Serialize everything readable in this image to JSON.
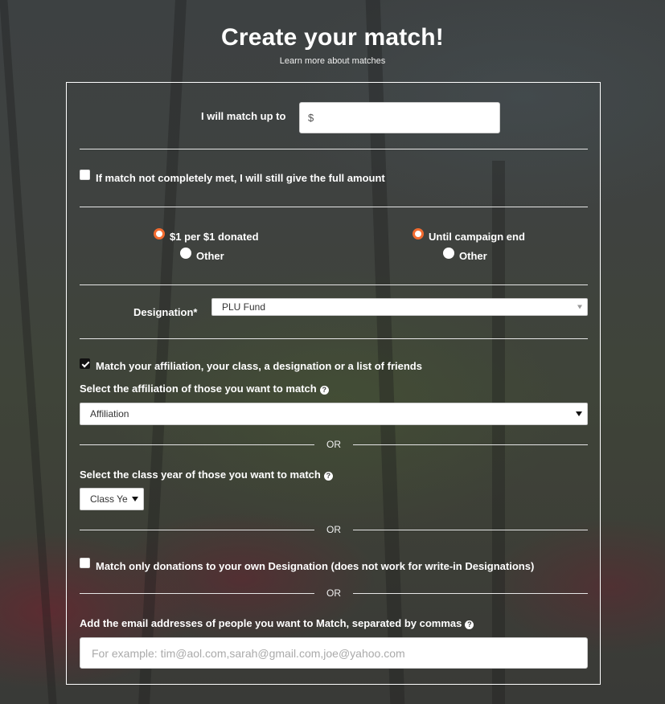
{
  "header": {
    "title": "Create your match!",
    "learn_more_link": "Learn more about matches"
  },
  "match_amount": {
    "label": "I will match up to",
    "value": "$"
  },
  "full_amount_checkbox": {
    "label": "If match not completely met, I will still give the full amount",
    "checked": false
  },
  "ratio_options": [
    {
      "label": "$1 per $1 donated",
      "selected": true
    },
    {
      "label": "Other",
      "selected": false
    }
  ],
  "duration_options": [
    {
      "label": "Until campaign end",
      "selected": true
    },
    {
      "label": "Other",
      "selected": false
    }
  ],
  "designation": {
    "label": "Designation*",
    "selected": "PLU Fund"
  },
  "match_targets_checkbox": {
    "label": "Match your affiliation, your class, a designation or a list of friends",
    "checked": true
  },
  "affiliation": {
    "label": "Select the affiliation of those you want to match",
    "selected": "Affiliation"
  },
  "or_text": "OR",
  "class_year": {
    "label": "Select the class year of those you want to match",
    "selected": "Class Ye"
  },
  "own_designation_checkbox": {
    "label": "Match only donations to your own Designation (does not work for write-in Designations)",
    "checked": false
  },
  "emails": {
    "label": "Add the email addresses of people you want to Match, separated by commas",
    "value": "",
    "placeholder": "For example: tim@aol.com,sarah@gmail.com,joe@yahoo.com"
  },
  "help_glyph": "?",
  "colors": {
    "radio_accent": "#f26b30",
    "text": "#ffffff",
    "frame": "#ffffff"
  }
}
